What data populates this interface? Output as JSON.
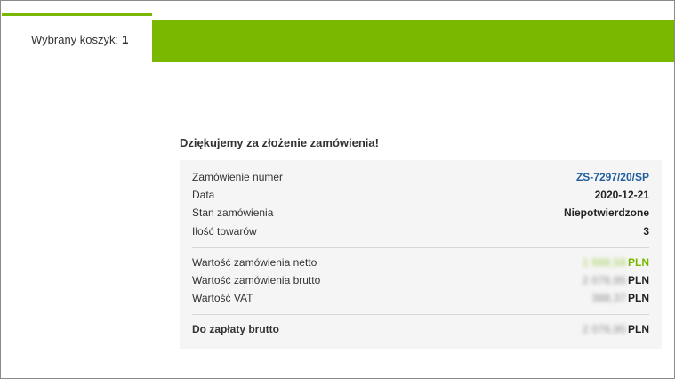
{
  "tabs": {
    "active_label": "Wybrany koszyk:",
    "active_count": "1"
  },
  "colors": {
    "accent": "#7ab800",
    "link": "#1f5f9e",
    "panel_bg": "#f5f5f5"
  },
  "confirmation": {
    "title": "Dziękujemy za złożenie zamówienia!",
    "details": [
      {
        "label": "Zamówienie numer",
        "value": "ZS-7297/20/SP"
      },
      {
        "label": "Data",
        "value": "2020-12-21"
      },
      {
        "label": "Stan zamówienia",
        "value": "Niepotwierdzone"
      },
      {
        "label": "Ilość towarów",
        "value": "3"
      }
    ],
    "amounts": [
      {
        "label": "Wartość zamówienia netto",
        "amount": "1 688,58",
        "currency": "PLN"
      },
      {
        "label": "Wartość zamówienia brutto",
        "amount": "2 076,95",
        "currency": "PLN"
      },
      {
        "label": "Wartość VAT",
        "amount": "388,37",
        "currency": "PLN"
      }
    ],
    "total": {
      "label": "Do zapłaty brutto",
      "amount": "2 076,95",
      "currency": "PLN"
    }
  }
}
